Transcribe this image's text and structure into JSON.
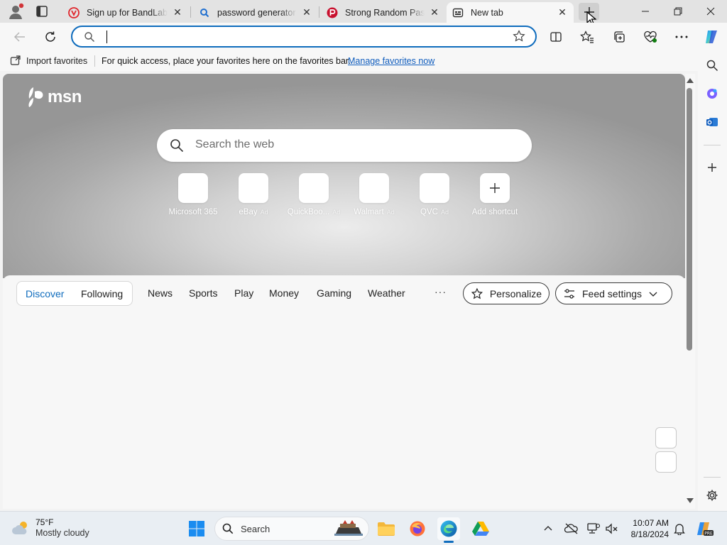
{
  "browser": {
    "tabs": [
      {
        "title": "Sign up for BandLab",
        "active": false
      },
      {
        "title": "password generator - Search",
        "active": false
      },
      {
        "title": "Strong Random Password Generator",
        "active": false
      },
      {
        "title": "New tab",
        "active": true
      }
    ],
    "address_bar": {
      "value": "",
      "placeholder": ""
    },
    "favorites_bar": {
      "import_label": "Import favorites",
      "message": "For quick access, place your favorites here on the favorites bar.",
      "manage_link": "Manage favorites now"
    }
  },
  "newtab": {
    "logo_text": "msn",
    "search_placeholder": "Search the web",
    "shortcuts": [
      {
        "label": "Microsoft 365",
        "ad": ""
      },
      {
        "label": "eBay",
        "ad": "Ad"
      },
      {
        "label": "QuickBoo...",
        "ad": "Ad"
      },
      {
        "label": "Walmart",
        "ad": "Ad"
      },
      {
        "label": "QVC",
        "ad": "Ad"
      },
      {
        "label": "Add shortcut",
        "ad": ""
      }
    ],
    "feed": {
      "pill_tabs": [
        "Discover",
        "Following"
      ],
      "tabs": [
        "News",
        "Sports",
        "Play",
        "Money",
        "Gaming",
        "Weather"
      ],
      "more": "···",
      "personalize": "Personalize",
      "feed_settings": "Feed settings"
    }
  },
  "taskbar": {
    "weather": {
      "temp": "75°F",
      "condition": "Mostly cloudy"
    },
    "search_label": "Search",
    "clock": {
      "time": "10:07 AM",
      "date": "8/18/2024"
    }
  },
  "colors": {
    "accent": "#0f6cbd",
    "tab_strip": "#e3e3e3",
    "toolbar": "#f7f7f7",
    "taskbar": "#e9eef3"
  }
}
